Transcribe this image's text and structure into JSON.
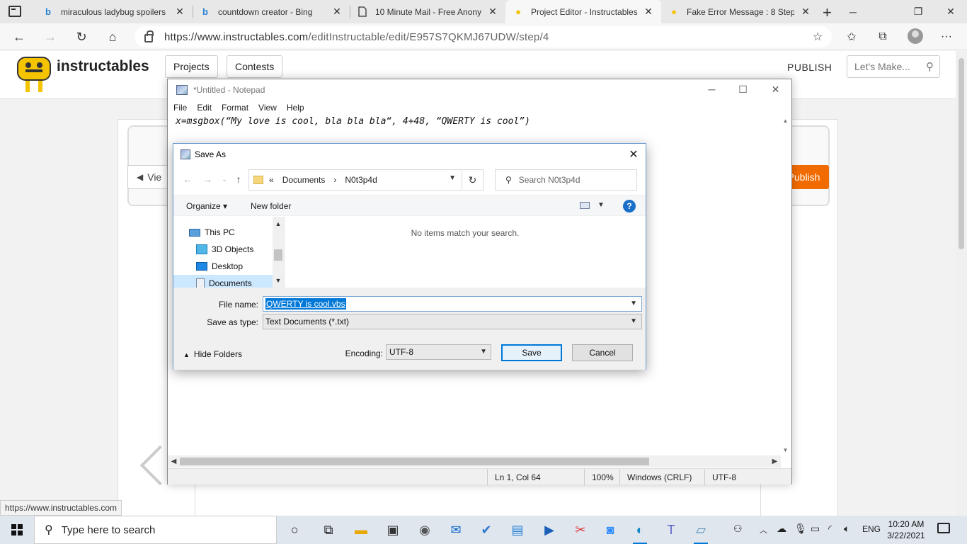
{
  "browser": {
    "tabs": [
      {
        "label": "miraculous ladybug spoilers -",
        "icon": "bing-icon",
        "active": false
      },
      {
        "label": "countdown creator - Bing",
        "icon": "bing-icon",
        "active": false
      },
      {
        "label": "10 Minute Mail - Free Anony",
        "icon": "page-icon",
        "active": false
      },
      {
        "label": "Project Editor - Instructables",
        "icon": "instructables-icon",
        "active": true
      },
      {
        "label": "Fake Error Message : 8 Steps",
        "icon": "instructables-icon",
        "active": false
      }
    ],
    "url_host": "https://www.instructables.com",
    "url_path": "/editInstructable/edit/E957S7QKMJ67UDW/step/4",
    "status_url": "https://www.instructables.com"
  },
  "site": {
    "logo": "instructables",
    "nav": [
      "Projects",
      "Contests"
    ],
    "publish_link": "PUBLISH",
    "search_placeholder": "Let's Make...",
    "view_btn": "Vie",
    "publish_btn": "Publish"
  },
  "notepad": {
    "title": "*Untitled - Notepad",
    "menu": [
      "File",
      "Edit",
      "Format",
      "View",
      "Help"
    ],
    "content": "x=msgbox(“My love is cool, bla bla bla“, 4+48, “QWERTY is cool”)",
    "status": {
      "position": "Ln 1, Col 64",
      "zoom": "100%",
      "line_ending": "Windows (CRLF)",
      "encoding": "UTF-8"
    }
  },
  "saveas": {
    "title": "Save As",
    "path": [
      "Documents",
      "N0t3p4d"
    ],
    "path_prefix": "«",
    "search_placeholder": "Search N0t3p4d",
    "organize": "Organize",
    "new_folder": "New folder",
    "tree": [
      "This PC",
      "3D Objects",
      "Desktop",
      "Documents"
    ],
    "empty_msg": "No items match your search.",
    "file_name_label": "File name:",
    "file_name": "QWERTY is cool.vbs",
    "type_label": "Save as type:",
    "type_value": "Text Documents (*.txt)",
    "hide_folders": "Hide Folders",
    "encoding_label": "Encoding:",
    "encoding_value": "UTF-8",
    "save": "Save",
    "cancel": "Cancel"
  },
  "taskbar": {
    "search_placeholder": "Type here to search",
    "language": "ENG",
    "time": "10:20 AM",
    "date": "3/22/2021"
  }
}
